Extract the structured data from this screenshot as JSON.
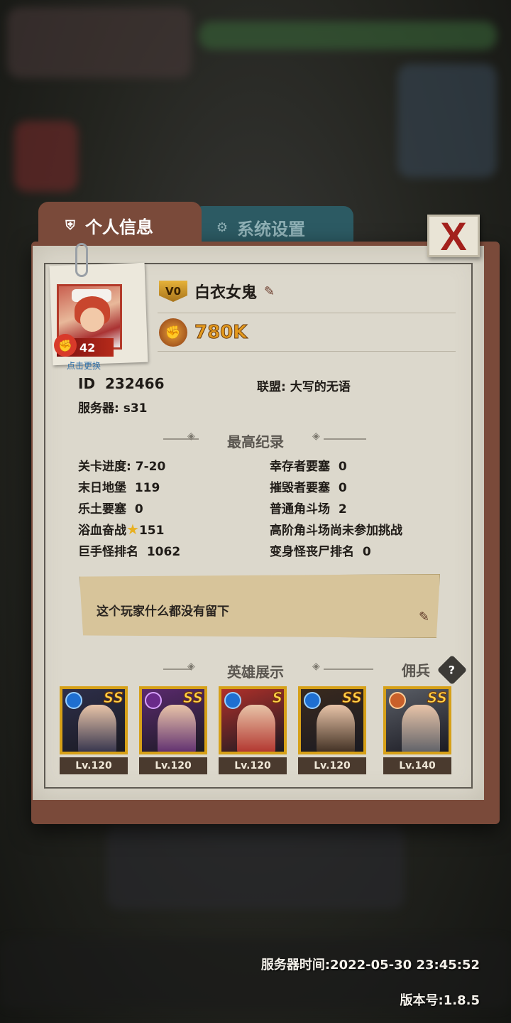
{
  "tabs": {
    "active": "个人信息",
    "inactive": "系统设置"
  },
  "profile": {
    "level": "42",
    "change_avatar": "点击更换",
    "vip": "V0",
    "name": "白衣女鬼",
    "power": "780K",
    "id_label": "ID",
    "id": "232466",
    "alliance_label": "联盟:",
    "alliance": "大写的无语",
    "server_label": "服务器:",
    "server": "s31"
  },
  "records": {
    "title": "最高纪录",
    "left": [
      {
        "label": "关卡进度:",
        "value": "7-20"
      },
      {
        "label": "末日地堡",
        "value": "119"
      },
      {
        "label": "乐土要塞",
        "value": "0"
      },
      {
        "label": "浴血奋战",
        "value": "151"
      },
      {
        "label": "巨手怪排名",
        "value": "1062"
      }
    ],
    "right": [
      {
        "label": "幸存者要塞",
        "value": "0"
      },
      {
        "label": "摧毁者要塞",
        "value": "0"
      },
      {
        "label": "普通角斗场",
        "value": "2"
      },
      {
        "label": "高阶角斗场尚未参加挑战",
        "value": ""
      },
      {
        "label": "变身怪丧尸排名",
        "value": "0"
      }
    ]
  },
  "message": "这个玩家什么都没有留下",
  "heroes": {
    "title": "英雄展示",
    "mercenary_label": "佣兵",
    "help": "?",
    "list": [
      {
        "grade": "SS",
        "level": "Lv.120",
        "color": "#2e2f4a"
      },
      {
        "grade": "SS",
        "level": "Lv.120",
        "color": "#5b2a6e"
      },
      {
        "grade": "S",
        "level": "Lv.120",
        "color": "#b0302a"
      },
      {
        "grade": "SS",
        "level": "Lv.120",
        "color": "#3a2a1e"
      },
      {
        "grade": "SS",
        "level": "Lv.140",
        "color": "#5a5e66"
      }
    ]
  },
  "footer": {
    "server_time": "服务器时间:2022-05-30  23:45:52",
    "version": "版本号:1.8.5"
  },
  "close": "X"
}
